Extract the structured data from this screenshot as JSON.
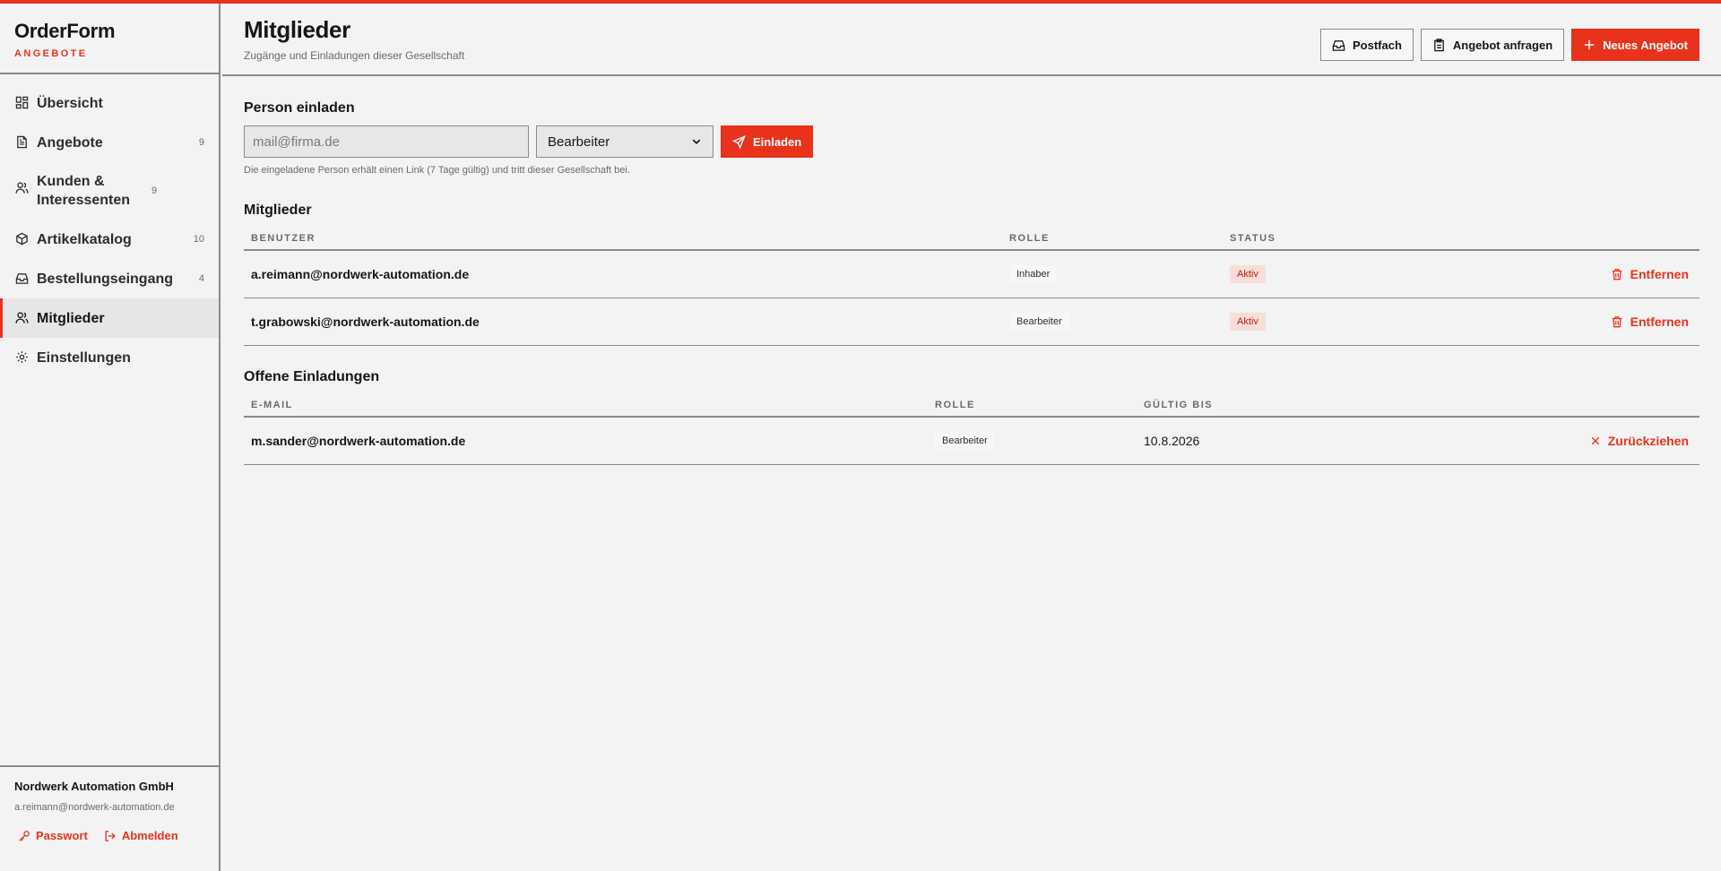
{
  "brand": {
    "name": "OrderForm",
    "sub": "ANGEBOTE"
  },
  "nav": {
    "items": [
      {
        "label": "Übersicht",
        "count": "",
        "icon": "dashboard-icon"
      },
      {
        "label": "Angebote",
        "count": "9",
        "icon": "document-icon"
      },
      {
        "label": "Kunden & Interessenten",
        "count": "9",
        "icon": "users-icon"
      },
      {
        "label": "Artikelkatalog",
        "count": "10",
        "icon": "package-icon"
      },
      {
        "label": "Bestellungseingang",
        "count": "4",
        "icon": "inbox-icon"
      },
      {
        "label": "Mitglieder",
        "count": "",
        "icon": "members-icon",
        "active": true
      },
      {
        "label": "Einstellungen",
        "count": "",
        "icon": "gear-icon"
      }
    ]
  },
  "footer": {
    "company": "Nordwerk Automation GmbH",
    "email": "a.reimann@nordwerk-automation.de",
    "password_label": "Passwort",
    "logout_label": "Abmelden"
  },
  "header": {
    "title": "Mitglieder",
    "subtitle": "Zugänge und Einladungen dieser Gesellschaft",
    "actions": {
      "inbox": "Postfach",
      "request": "Angebot anfragen",
      "new_offer": "Neues Angebot"
    }
  },
  "invite": {
    "title": "Person einladen",
    "placeholder": "mail@firma.de",
    "role_selected": "Bearbeiter",
    "button": "Einladen",
    "hint": "Die eingeladene Person erhält einen Link (7 Tage gültig) und tritt dieser Gesellschaft bei."
  },
  "members": {
    "title": "Mitglieder",
    "headers": {
      "user": "BENUTZER",
      "role": "ROLLE",
      "status": "STATUS"
    },
    "rows": [
      {
        "email": "a.reimann@nordwerk-automation.de",
        "role": "Inhaber",
        "status": "Aktiv",
        "action": "Entfernen"
      },
      {
        "email": "t.grabowski@nordwerk-automation.de",
        "role": "Bearbeiter",
        "status": "Aktiv",
        "action": "Entfernen"
      }
    ]
  },
  "invitations": {
    "title": "Offene Einladungen",
    "headers": {
      "email": "E-MAIL",
      "role": "ROLLE",
      "valid_until": "GÜLTIG BIS"
    },
    "rows": [
      {
        "email": "m.sander@nordwerk-automation.de",
        "role": "Bearbeiter",
        "valid_until": "10.8.2026",
        "action": "Zurückziehen"
      }
    ]
  },
  "colors": {
    "accent": "#e8321c",
    "border": "#8a8a8a",
    "background": "#f3f3f3"
  }
}
